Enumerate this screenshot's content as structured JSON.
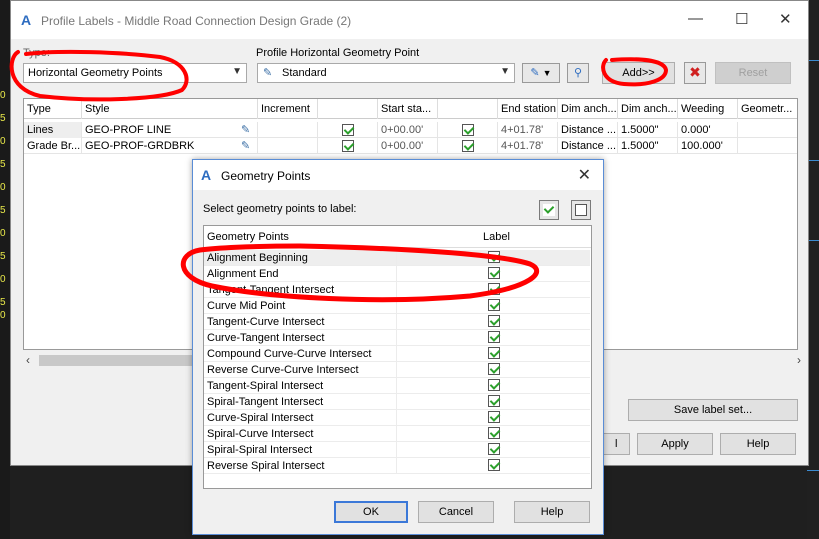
{
  "background": {
    "ticks": [
      "0",
      "5",
      "0",
      "5",
      "0",
      "5",
      "0",
      "5",
      "0",
      "5",
      "0"
    ]
  },
  "main_dialog": {
    "title": "Profile Labels - Middle Road Connection Design Grade (2)",
    "type_label": "Type:",
    "type_value": "Horizontal Geometry Points",
    "style_label": "Profile Horizontal Geometry Point",
    "style_value": "Standard",
    "add_label": "Add>>",
    "reset_label": "Reset",
    "columns": [
      "Type",
      "Style",
      "Increment",
      "",
      "Start sta...",
      "",
      "End station",
      "Dim anch...",
      "Dim anch...",
      "Weeding",
      "Geometr..."
    ],
    "rows": [
      {
        "type": "Lines",
        "style": "GEO-PROF LINE",
        "start": "0+00.00'",
        "end": "4+01.78'",
        "dim1": "Distance ...",
        "dim2": "1.5000\"",
        "weeding": "0.000'"
      },
      {
        "type": "Grade Br...",
        "style": "GEO-PROF-GRDBRK",
        "start": "0+00.00'",
        "end": "4+01.78'",
        "dim1": "Distance ...",
        "dim2": "1.5000\"",
        "weeding": "100.000'"
      }
    ],
    "save_label_set": "Save label set...",
    "partial_button": "l",
    "apply_label": "Apply",
    "help_label": "Help"
  },
  "geometry_dialog": {
    "title": "Geometry Points",
    "instruction": "Select geometry points to label:",
    "col_points": "Geometry Points",
    "col_label": "Label",
    "items": [
      "Alignment Beginning",
      "Alignment End",
      "Tangent-Tangent Intersect",
      "Curve Mid Point",
      "Tangent-Curve Intersect",
      "Curve-Tangent Intersect",
      "Compound Curve-Curve Intersect",
      "Reverse Curve-Curve Intersect",
      "Tangent-Spiral Intersect",
      "Spiral-Tangent Intersect",
      "Curve-Spiral Intersect",
      "Spiral-Curve Intersect",
      "Spiral-Spiral Intersect",
      "Reverse Spiral Intersect"
    ],
    "ok_label": "OK",
    "cancel_label": "Cancel",
    "help_label": "Help"
  },
  "colors": {
    "accent": "#2d6cc0",
    "check": "#2ca02c",
    "annotation": "#ff0000",
    "bg_tick": "#e8e84a"
  }
}
